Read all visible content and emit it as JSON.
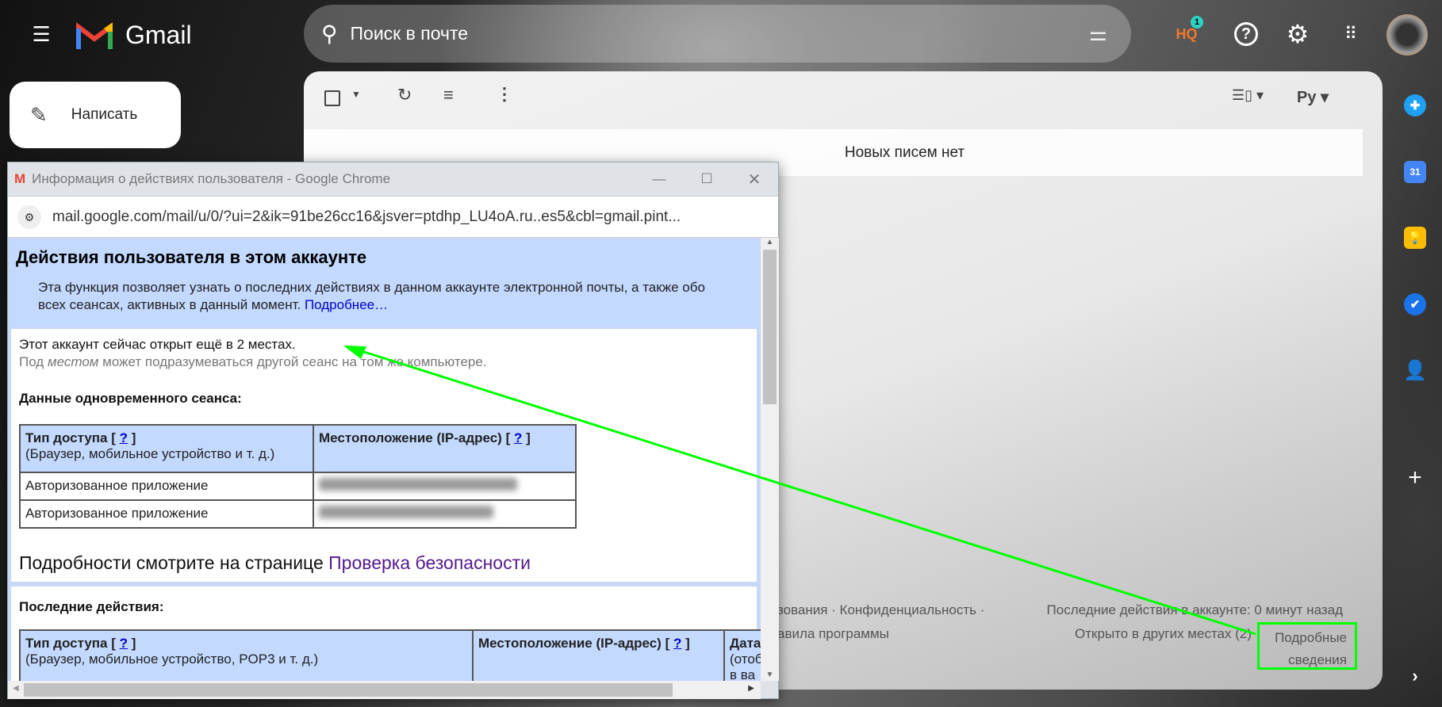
{
  "gmail": {
    "logo_text": "Gmail",
    "search_placeholder": "Поиск в почте",
    "compose_label": "Написать",
    "cloudhq_badge": "1",
    "cloudhq_text": "HQ",
    "language": "Ру",
    "empty_message": "Новых писем нет",
    "footer": {
      "links_line1": "зования · Конфиденциальность ·",
      "links_line2": "авила программы",
      "last_activity": "Последние действия в аккаунте: 0 минут назад",
      "open_elsewhere": "Открыто в других местах (2)",
      "details_link": "Подробные сведения"
    },
    "side_apps": [
      "keep-plus",
      "calendar",
      "keep",
      "tasks",
      "contacts"
    ],
    "calendar_day": "31",
    "highlight_color": "#00ff00"
  },
  "popup": {
    "title": "Информация о действиях пользователя - Google Chrome",
    "url": "mail.google.com/mail/u/0/?ui=2&ik=91be26cc16&jsver=ptdhp_LU4oA.ru..es5&cbl=gmail.pint...",
    "heading": "Действия пользователя в этом аккаунте",
    "intro": "Эта функция позволяет узнать о последних действиях в данном аккаунте электронной почты, а также обо всех сеансах, активных в данный момент. ",
    "learn_more": "Подробнее…",
    "open_places": "Этот аккаунт сейчас открыт ещё в 2 местах.",
    "place_note_pre": "Под ",
    "place_note_em": "местом",
    "place_note_post": " может подразумеваться другой сеанс на том же компьютере.",
    "concurrent_title": "Данные одновременного сеанса:",
    "table1": {
      "col1_title": "Тип доступа",
      "col1_sub": "(Браузер, мобильное устройство и т. д.)",
      "col2_title": "Местоположение (IP-адрес)",
      "help": "?",
      "rows": [
        {
          "type": "Авторизованное приложение"
        },
        {
          "type": "Авторизованное приложение"
        }
      ]
    },
    "security_pre": "Подробности смотрите на странице ",
    "security_link": "Проверка безопасности",
    "recent_title": "Последние действия:",
    "table2": {
      "col1_title": "Тип доступа",
      "col1_sub": "(Браузер, мобильное устройство, POP3 и т. д.)",
      "col2_title": "Местоположение (IP-адрес)",
      "col3_title": "Дата",
      "col3_sub": "(отоб",
      "col3_sub2": "в ва",
      "help": "?"
    }
  }
}
